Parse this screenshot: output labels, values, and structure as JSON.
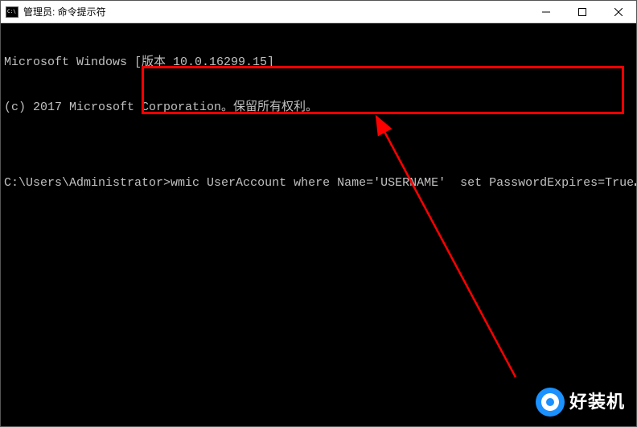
{
  "window": {
    "title": "管理员: 命令提示符"
  },
  "terminal": {
    "line1": "Microsoft Windows [版本 10.0.16299.15]",
    "line2": "(c) 2017 Microsoft Corporation。保留所有权利。",
    "blank": "",
    "prompt": "C:\\Users\\Administrator>",
    "command": "wmic UserAccount where Name='USERNAME'  set PasswordExpires=True"
  },
  "watermark": {
    "text": "好装机"
  }
}
